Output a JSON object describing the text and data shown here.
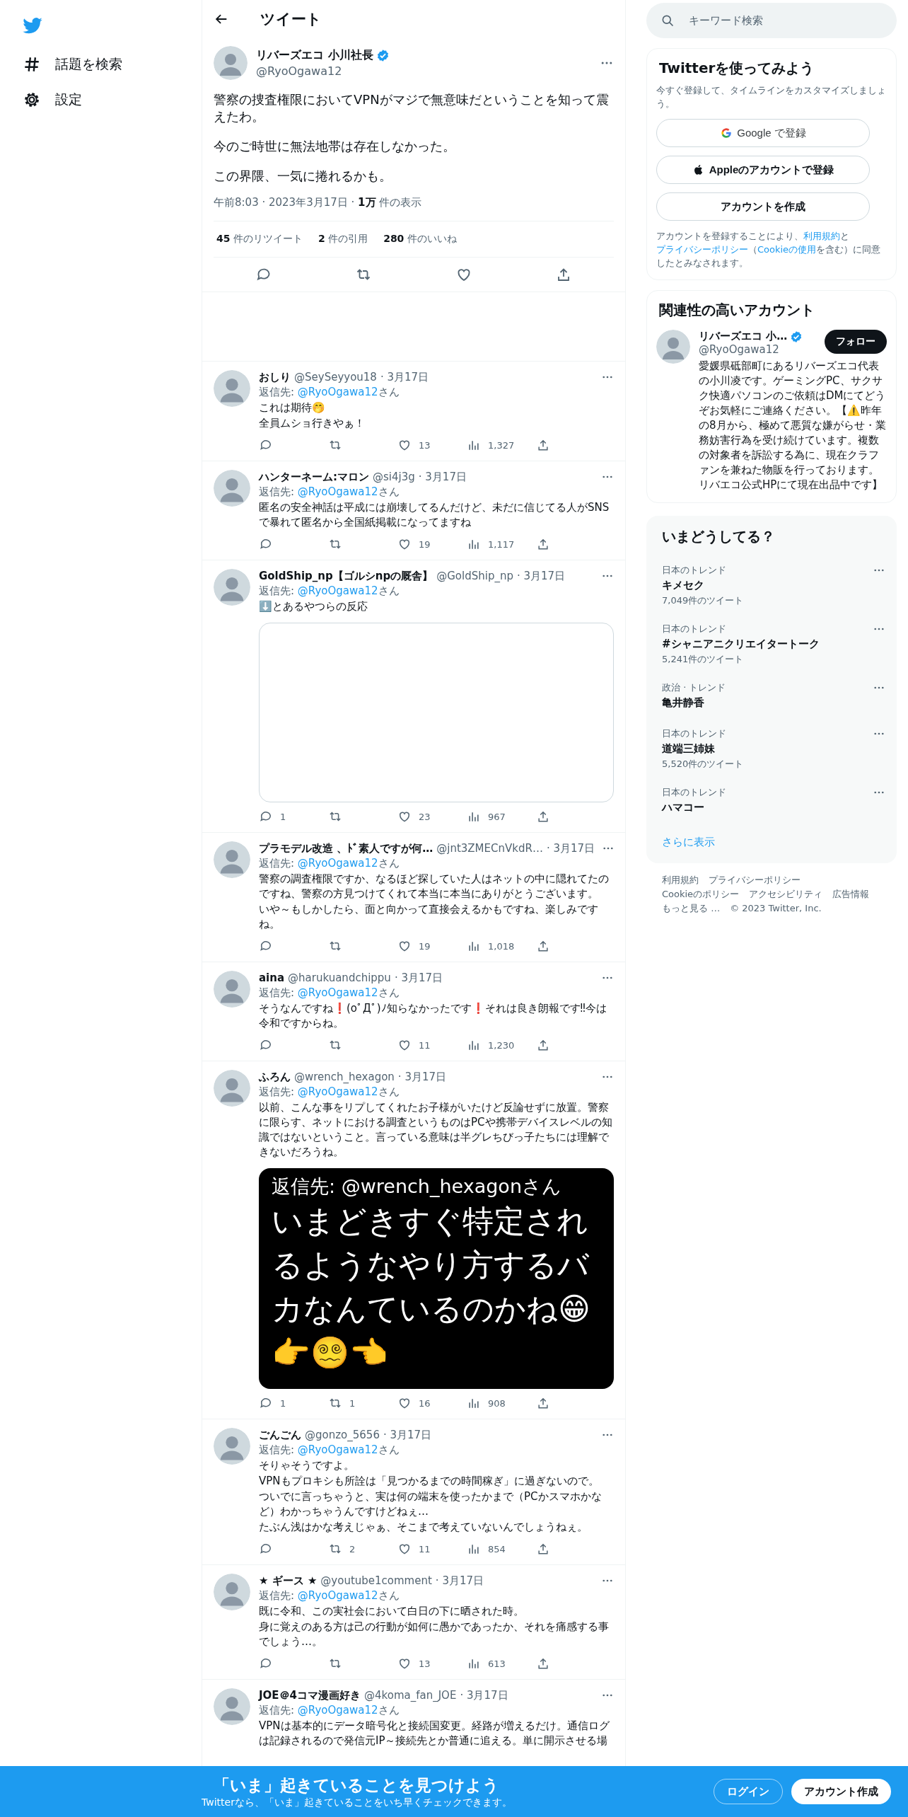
{
  "nav": {
    "items": [
      {
        "label": "話題を検索"
      },
      {
        "label": "設定"
      }
    ]
  },
  "header": {
    "title": "ツイート"
  },
  "tweet": {
    "author": {
      "name": "リバーズエコ 小川社長",
      "handle": "@RyoOgawa12",
      "verified": true
    },
    "paragraphs": [
      "警察の捜査権限においてVPNがマジで無意味だということを知って震えたわ。",
      "今のご時世に無法地帯は存在しなかった。",
      "この界隈、一気に捲れるかも。"
    ],
    "meta": "午前8:03 · 2023年3月17日 · **1万** 件の表示",
    "stats": [
      "**45** 件のリツイート",
      "**2** 件の引用",
      "**280** 件のいいね"
    ]
  },
  "replies": [
    {
      "name": "おしり",
      "handle": "@SeySeyyou18",
      "date": "· 3月17日",
      "reply_to": {
        "label": "返信先:",
        "mention": "@RyoOgawa12",
        "suffix": "さん"
      },
      "text": [
        "これは期待🤭",
        "全員ムショ行きやぁ！"
      ],
      "actions": {
        "likes": "13",
        "views": "1,327"
      }
    },
    {
      "name": "ハンターネーム:マロン",
      "handle": "@si4j3g",
      "date": "· 3月17日",
      "reply_to": {
        "label": "返信先:",
        "mention": "@RyoOgawa12",
        "suffix": "さん"
      },
      "text": [
        "匿名の安全神話は平成には崩壊してるんだけど、未だに信じてる人がSNSで暴れて匿名から全国紙掲載になってますね"
      ],
      "actions": {
        "likes": "19",
        "views": "1,117"
      }
    },
    {
      "name": "GoldShip_np【ゴルシnpの厩舎】",
      "handle": "@GoldShip_np",
      "date": "· 3月17日",
      "reply_to": {
        "label": "返信先:",
        "mention": "@RyoOgawa12",
        "suffix": "さん"
      },
      "text": [
        "⬇️とあるやつらの反応"
      ],
      "media": {
        "kind": "blank"
      },
      "actions": {
        "replies": "1",
        "likes": "23",
        "views": "967"
      }
    },
    {
      "name": "プラモデル改造 、ﾄﾞ素人ですが何…",
      "handle": "@jnt3ZMECnVkdR…",
      "date": "· 3月17日",
      "reply_to": {
        "label": "返信先:",
        "mention": "@RyoOgawa12",
        "suffix": "さん"
      },
      "text": [
        "警察の調査権限ですか、なるほど探していた人はネットの中に隠れてたのですね、警察の方見つけてくれて本当に本当にありがとうございます。",
        "いや～もしかしたら、面と向かって直接会えるかもですね、楽しみですね。"
      ],
      "actions": {
        "likes": "19",
        "views": "1,018"
      }
    },
    {
      "name": "aina",
      "handle": "@harukuandchippu",
      "date": "· 3月17日",
      "reply_to": {
        "label": "返信先:",
        "mention": "@RyoOgawa12",
        "suffix": "さん"
      },
      "text": [
        "そうなんですね❗(oﾟДﾟ)ﾉ知らなかったです❗それは良き朗報です‼今は令和ですからね。"
      ],
      "actions": {
        "likes": "11",
        "views": "1,230"
      }
    },
    {
      "name": "ふろん",
      "handle": "@wrench_hexagon",
      "date": "· 3月17日",
      "reply_to": {
        "label": "返信先:",
        "mention": "@RyoOgawa12",
        "suffix": "さん"
      },
      "text": [
        "以前、こんな事をリプしてくれたお子様がいたけど反論せずに放置。警察に限らす、ネットにおける調査というものはPCや携帯デバイスレベルの知識ではないということ。言っている意味は半グレちびっ子たちには理解できないだろうね。"
      ],
      "media": {
        "kind": "text_image",
        "lines": [
          "返信先: @wrench_hexagonさん",
          "いまどきすぐ特定されるようなやり方するバカなんているのかね😁",
          "👉😵‍💫👈"
        ]
      },
      "actions": {
        "replies": "1",
        "retweets": "1",
        "likes": "16",
        "views": "908"
      }
    },
    {
      "name": "ごんごん",
      "handle": "@gonzo_5656",
      "date": "· 3月17日",
      "reply_to": {
        "label": "返信先:",
        "mention": "@RyoOgawa12",
        "suffix": "さん"
      },
      "text": [
        "そりゃそうですよ。",
        "VPNもプロキシも所詮は「見つかるまでの時間稼ぎ」に過ぎないので。",
        "ついでに言っちゃうと、実は何の端末を使ったかまで（PCかスマホかなど）わかっちゃうんですけどねぇ…",
        "たぶん浅はかな考えじゃぁ、そこまで考えていないんでしょうねぇ。"
      ],
      "actions": {
        "retweets": "2",
        "likes": "11",
        "views": "854"
      }
    },
    {
      "name": "★ ギース ★",
      "handle": "@youtube1comment",
      "date": "· 3月17日",
      "reply_to": {
        "label": "返信先:",
        "mention": "@RyoOgawa12",
        "suffix": "さん"
      },
      "text": [
        "既に令和、この実社会において白日の下に晒された時。",
        "身に覚えのある方は己の行動が如何に愚かであったか、それを痛感する事でしょう…。"
      ],
      "actions": {
        "likes": "13",
        "views": "613"
      }
    },
    {
      "name": "JOE＠4コマ漫画好き",
      "handle": "@4koma_fan_JOE",
      "date": "· 3月17日",
      "reply_to": {
        "label": "返信先:",
        "mention": "@RyoOgawa12",
        "suffix": "さん"
      },
      "text": [
        "VPNは基本的にデータ暗号化と接続国変更。経路が増えるだけ。通信ログは記録されるので発信元IP～接続先とか普通に追える。単に開示させる場"
      ]
    }
  ],
  "search": {
    "placeholder": "キーワード検索"
  },
  "signup": {
    "title": "Twitterを使ってみよう",
    "subtitle": "今すぐ登録して、タイムラインをカスタマイズしましょう。",
    "buttons": [
      {
        "kind": "google",
        "label": "Google で登録"
      },
      {
        "kind": "apple",
        "label": "Appleのアカウントで登録"
      },
      {
        "kind": "plain",
        "label": "アカウントを作成"
      }
    ],
    "legal": [
      {
        "text": "アカウントを登録することにより、",
        "link": false
      },
      {
        "text": "利用規約",
        "link": true
      },
      {
        "text": "と",
        "link": false
      },
      {
        "text": "プライバシーポリシー",
        "link": true
      },
      {
        "text": "（",
        "link": false
      },
      {
        "text": "Cookieの使用",
        "link": true
      },
      {
        "text": "を含む）に同意したとみなされます。",
        "link": false
      }
    ]
  },
  "related": {
    "title": "関連性の高いアカウント",
    "account": {
      "name": "リバーズエコ 小…",
      "handle": "@RyoOgawa12",
      "verified": true,
      "follow": "フォロー",
      "bio": "愛媛県砥部町にあるリバーズエコ代表の小川凌です。ゲーミングPC、サクサク快適パソコンのご依頼はDMにてどうぞお気軽にご連絡ください。【⚠️昨年の8月から、極めて悪質な嫌がらせ・業務妨害行為を受け続けています。複数の対象者を訴訟する為に、現在クラファンを兼ねた物販を行っております。リバエコ公式HPにて現在出品中です】"
    }
  },
  "trends": {
    "title": "いまどうしてる？",
    "items": [
      {
        "context": "日本のトレンド",
        "name": "キメセク",
        "count": "7,049件のツイート"
      },
      {
        "context": "日本のトレンド",
        "name": "#シャニアニクリエイタートーク",
        "count": "5,241件のツイート"
      },
      {
        "context": "政治 · トレンド",
        "name": "亀井静香"
      },
      {
        "context": "日本のトレンド",
        "name": "道端三姉妹",
        "count": "5,520件のツイート"
      },
      {
        "context": "日本のトレンド",
        "name": "ハマコー"
      }
    ],
    "more": "さらに表示"
  },
  "footer": {
    "links": [
      [
        "利用規約",
        "プライバシーポリシー"
      ],
      [
        "Cookieのポリシー",
        "アクセシビリティ",
        "広告情報"
      ],
      [
        "もっと見る …"
      ]
    ],
    "copyright": "© 2023 Twitter, Inc."
  },
  "banner": {
    "title": "「いま」起きていることを見つけよう",
    "subtitle": "Twitterなら、「いま」起きていることをいち早くチェックできます。",
    "login": "ログイン",
    "signup": "アカウント作成"
  }
}
